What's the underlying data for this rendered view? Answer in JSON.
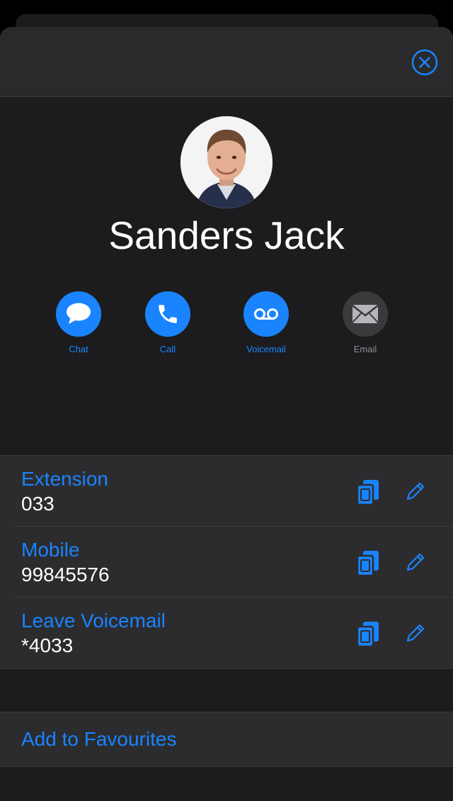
{
  "contact": {
    "name": "Sanders Jack"
  },
  "actions": [
    {
      "label": "Chat",
      "icon": "chat-bubble-icon",
      "color": "#1a84ff",
      "label_color": "#1a84ff"
    },
    {
      "label": "Call",
      "icon": "phone-icon",
      "color": "#1a84ff",
      "label_color": "#1a84ff"
    },
    {
      "label": "Voicemail",
      "icon": "voicemail-icon",
      "color": "#1a84ff",
      "label_color": "#1a84ff"
    },
    {
      "label": "Email",
      "icon": "envelope-icon",
      "color": "#3a3a3c",
      "label_color": "#8e8e93"
    }
  ],
  "details": [
    {
      "title": "Extension",
      "value": "033"
    },
    {
      "title": "Mobile",
      "value": "99845576"
    },
    {
      "title": "Leave Voicemail",
      "value": "*4033"
    }
  ],
  "favourites": {
    "label": "Add to Favourites"
  },
  "colors": {
    "accent": "#1a84ff",
    "background": "#1c1c1e",
    "cell": "#2c2c2e"
  }
}
